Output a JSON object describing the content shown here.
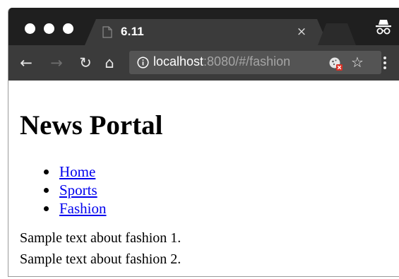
{
  "browser": {
    "tab": {
      "title": "6.11",
      "close_glyph": "×",
      "favicon": "document-icon"
    },
    "address_bar": {
      "url_host": "localhost",
      "url_rest": ":8080/#/fashion"
    },
    "icons": {
      "back": "←",
      "forward": "→",
      "reload": "↻",
      "home": "⌂",
      "star": "☆"
    },
    "colors": {
      "tab_strip": "#1f1f1f",
      "toolbar": "#3b3b3b",
      "omnibox": "#545454",
      "link": "#0000ee"
    }
  },
  "page": {
    "title": "News Portal",
    "nav": [
      {
        "label": "Home"
      },
      {
        "label": "Sports"
      },
      {
        "label": "Fashion"
      }
    ],
    "paragraphs": [
      "Sample text about fashion 1.",
      "Sample text about fashion 2."
    ]
  }
}
